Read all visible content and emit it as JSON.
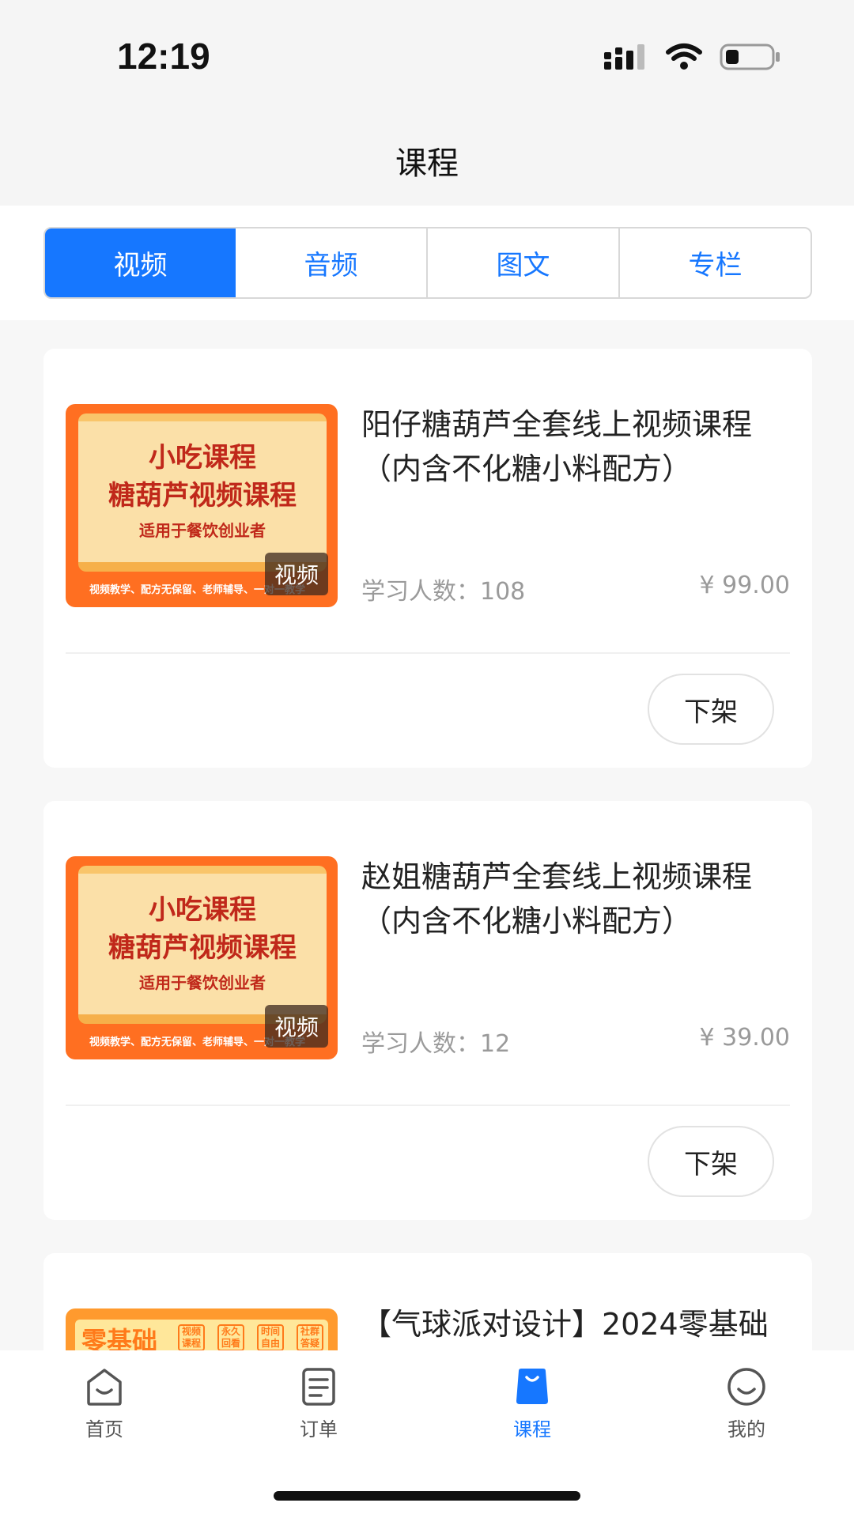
{
  "status_bar": {
    "time": "12:19"
  },
  "header": {
    "title": "课程"
  },
  "tabs": [
    {
      "label": "视频",
      "active": true
    },
    {
      "label": "音频",
      "active": false
    },
    {
      "label": "图文",
      "active": false
    },
    {
      "label": "专栏",
      "active": false
    }
  ],
  "courses": [
    {
      "title": "阳仔糖葫芦全套线上视频课程（内含不化糖小料配方）",
      "learners": "学习人数：108",
      "price": "¥ 99.00",
      "action": "下架",
      "thumb": {
        "line1": "小吃课程",
        "line2": "糖葫芦视频课程",
        "line3": "适用于餐饮创业者",
        "footer": "视频教学、配方无保留、老师辅导、一对一教学",
        "badge": "视频"
      }
    },
    {
      "title": "赵姐糖葫芦全套线上视频课程（内含不化糖小料配方）",
      "learners": "学习人数：12",
      "price": "¥ 39.00",
      "action": "下架",
      "thumb": {
        "line1": "小吃课程",
        "line2": "糖葫芦视频课程",
        "line3": "适用于餐饮创业者",
        "footer": "视频教学、配方无保留、老师辅导、一对一教学",
        "badge": "视频"
      }
    },
    {
      "title": "【气球派对设计】2024零基础",
      "thumb": {
        "big": "零基础",
        "chips": [
          "视频课程",
          "永久回看",
          "时间自由",
          "社群答疑"
        ]
      }
    }
  ],
  "bottom_nav": [
    {
      "label": "首页",
      "icon": "home-icon",
      "active": false
    },
    {
      "label": "订单",
      "icon": "order-icon",
      "active": false
    },
    {
      "label": "课程",
      "icon": "course-bag-icon",
      "active": true
    },
    {
      "label": "我的",
      "icon": "smile-face-icon",
      "active": false
    }
  ],
  "colors": {
    "accent": "#1677ff",
    "muted_text": "#9a9a9a",
    "thumb_orange": "#ff6f21"
  }
}
